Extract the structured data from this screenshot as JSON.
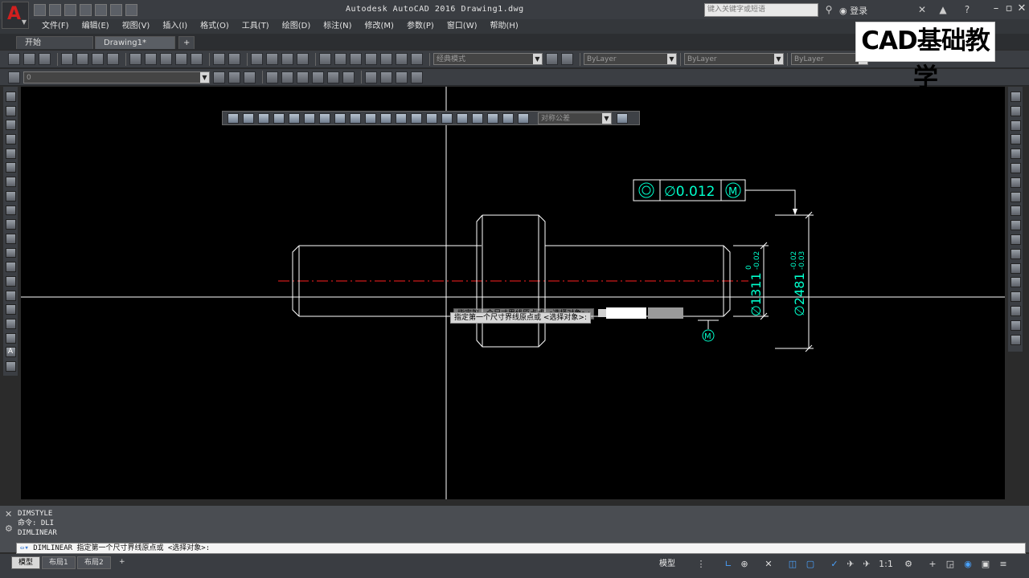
{
  "app": {
    "title": "Autodesk AutoCAD 2016    Drawing1.dwg",
    "logo_letter": "A",
    "search_placeholder": "键入关键字或短语",
    "sign_in": "登录"
  },
  "menu": [
    "文件(F)",
    "编辑(E)",
    "视图(V)",
    "插入(I)",
    "格式(O)",
    "工具(T)",
    "绘图(D)",
    "标注(N)",
    "修改(M)",
    "参数(P)",
    "窗口(W)",
    "帮助(H)"
  ],
  "doc_tabs": [
    {
      "label": "开始",
      "active": false
    },
    {
      "label": "Drawing1*",
      "active": true
    },
    {
      "label": "+",
      "active": false
    }
  ],
  "watermark": "CAD基础教学",
  "toolbars": {
    "text_style": "经典模式",
    "layer": "ByLayer",
    "linetype": "ByLayer",
    "lineweight": "ByLayer",
    "layer_state": "0",
    "dim_style": "对称公差"
  },
  "drawing": {
    "tolerance_value": "∅0.012",
    "dim_small": "∅1311",
    "dim_small_tol_upper": "0",
    "dim_small_tol_lower": "-0.02",
    "dim_large": "∅2481",
    "dim_large_tol_upper": "-0.02",
    "dim_large_tol_lower": "-0.03",
    "datum_symbol": "M",
    "colors": {
      "outline": "#ffffff",
      "dimension": "#00ffcc",
      "centerline": "#ff2020"
    }
  },
  "prompt_tooltip": "指定第一个尺寸界线原点或 <选择对象>:",
  "command_history": [
    "DIMSTYLE",
    "命令: DLI",
    "DIMLINEAR"
  ],
  "command_line": "DIMLINEAR 指定第一个尺寸界线原点或 <选择对象>:",
  "layout_tabs": [
    "模型",
    "布局1",
    "布局2",
    "+"
  ],
  "status": {
    "model_label": "模型",
    "scale": "1:1"
  }
}
